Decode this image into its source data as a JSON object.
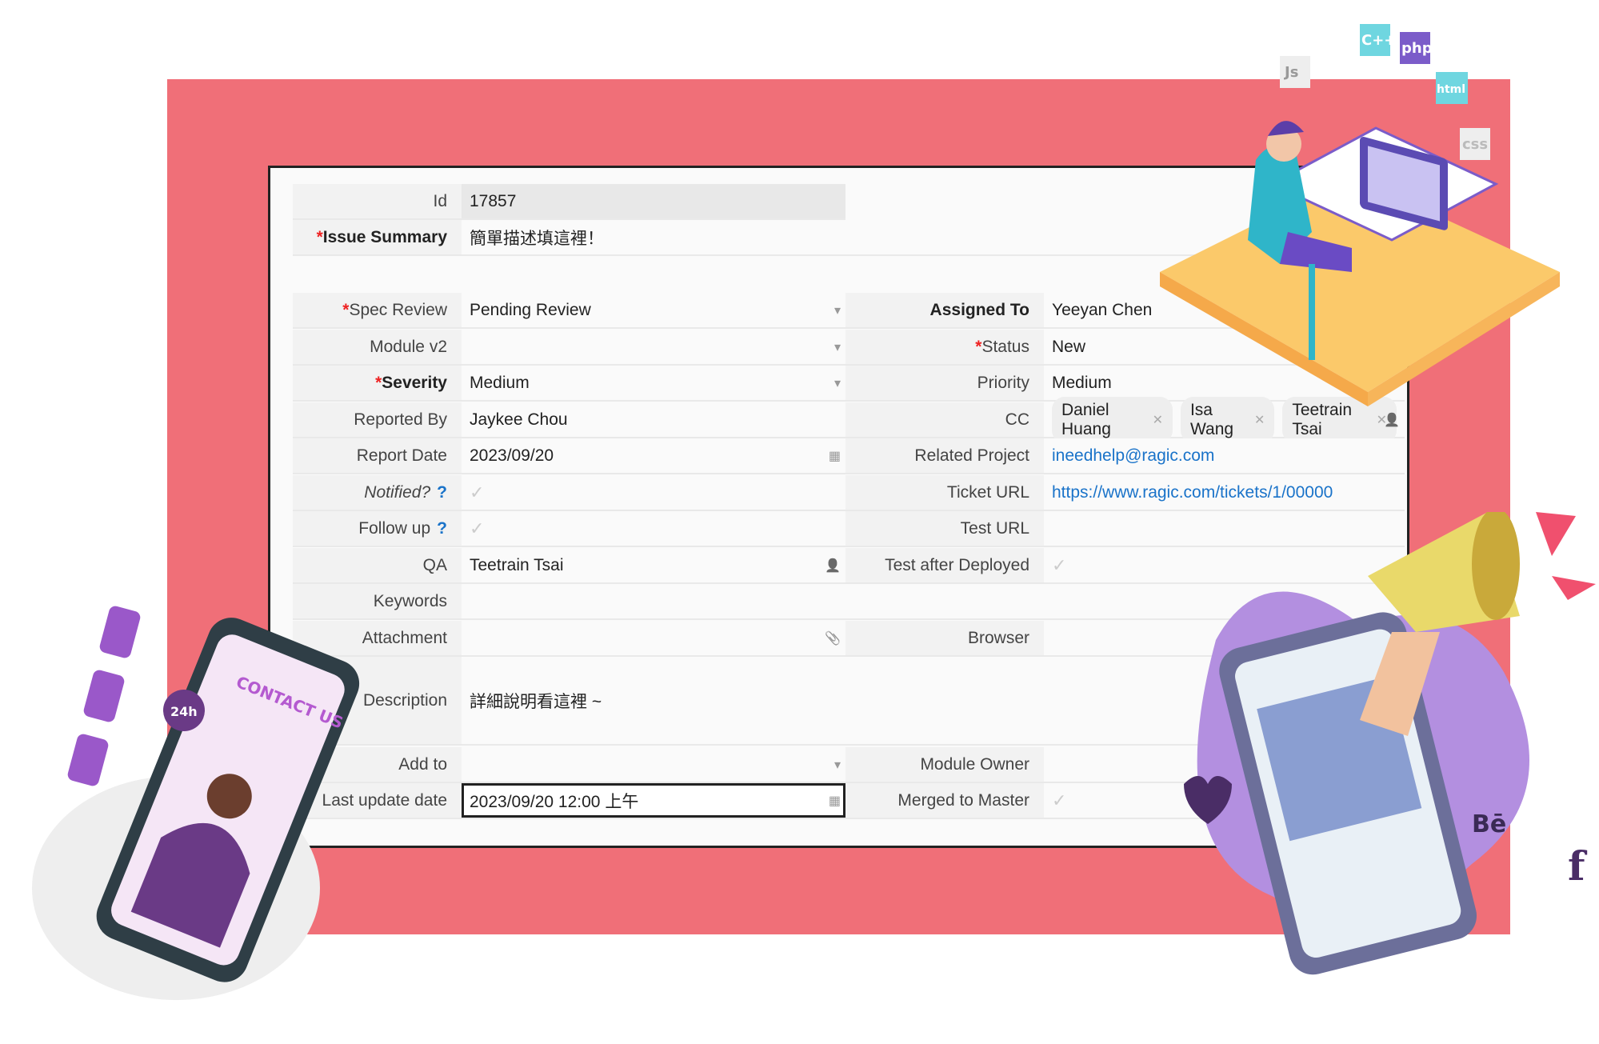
{
  "colors": {
    "frame": "#f06f78",
    "link": "#1a73c9",
    "required": "#e22222"
  },
  "form": {
    "id": {
      "label": "Id",
      "value": "17857"
    },
    "issue_summary": {
      "label": "Issue Summary",
      "value": "簡單描述填這裡！"
    },
    "spec_review": {
      "label": "Spec Review",
      "value": "Pending Review"
    },
    "assigned_to": {
      "label": "Assigned To",
      "value": "Yeeyan Chen"
    },
    "module_v2": {
      "label": "Module v2",
      "value": ""
    },
    "status": {
      "label": "Status",
      "value": "New"
    },
    "severity": {
      "label": "Severity",
      "value": "Medium"
    },
    "priority": {
      "label": "Priority",
      "value": "Medium"
    },
    "reported_by": {
      "label": "Reported By",
      "value": "Jaykee Chou"
    },
    "cc": {
      "label": "CC",
      "tags": [
        "Daniel Huang",
        "Isa Wang",
        "Teetrain Tsai"
      ]
    },
    "report_date": {
      "label": "Report Date",
      "value": "2023/09/20"
    },
    "related_project": {
      "label": "Related Project",
      "value": "ineedhelp@ragic.com"
    },
    "notified": {
      "label": "Notified?",
      "help": "?",
      "checked": false
    },
    "ticket_url": {
      "label": "Ticket URL",
      "value": "https://www.ragic.com/tickets/1/00000"
    },
    "follow_up": {
      "label": "Follow up",
      "help": "?",
      "checked": false
    },
    "test_url": {
      "label": "Test URL",
      "value": ""
    },
    "qa": {
      "label": "QA",
      "value": "Teetrain Tsai"
    },
    "test_after_deployed": {
      "label": "Test after Deployed",
      "checked": false
    },
    "keywords": {
      "label": "Keywords",
      "value": ""
    },
    "attachment": {
      "label": "Attachment",
      "value": ""
    },
    "browser": {
      "label": "Browser",
      "value": ""
    },
    "description": {
      "label": "Description",
      "value": "詳細說明看這裡 ~"
    },
    "add_to": {
      "label": "Add to",
      "value": ""
    },
    "module_owner": {
      "label": "Module Owner",
      "value": ""
    },
    "last_update_date": {
      "label": "Last update date",
      "value": "2023/09/20 12:00 上午"
    },
    "merged_to_master": {
      "label": "Merged to Master",
      "checked": false
    }
  },
  "symbols": {
    "required": "*",
    "check": "✓",
    "dropdown": "▾",
    "calendar": "▦",
    "person": "👤",
    "clip": "📎",
    "remove": "✕"
  },
  "illustrations": {
    "phone_sign": "CONTACT US",
    "badge_24h": "24h",
    "code_tags": [
      "Js",
      "C++",
      "php",
      "html",
      "css"
    ],
    "social": [
      "Bē",
      "f"
    ]
  }
}
